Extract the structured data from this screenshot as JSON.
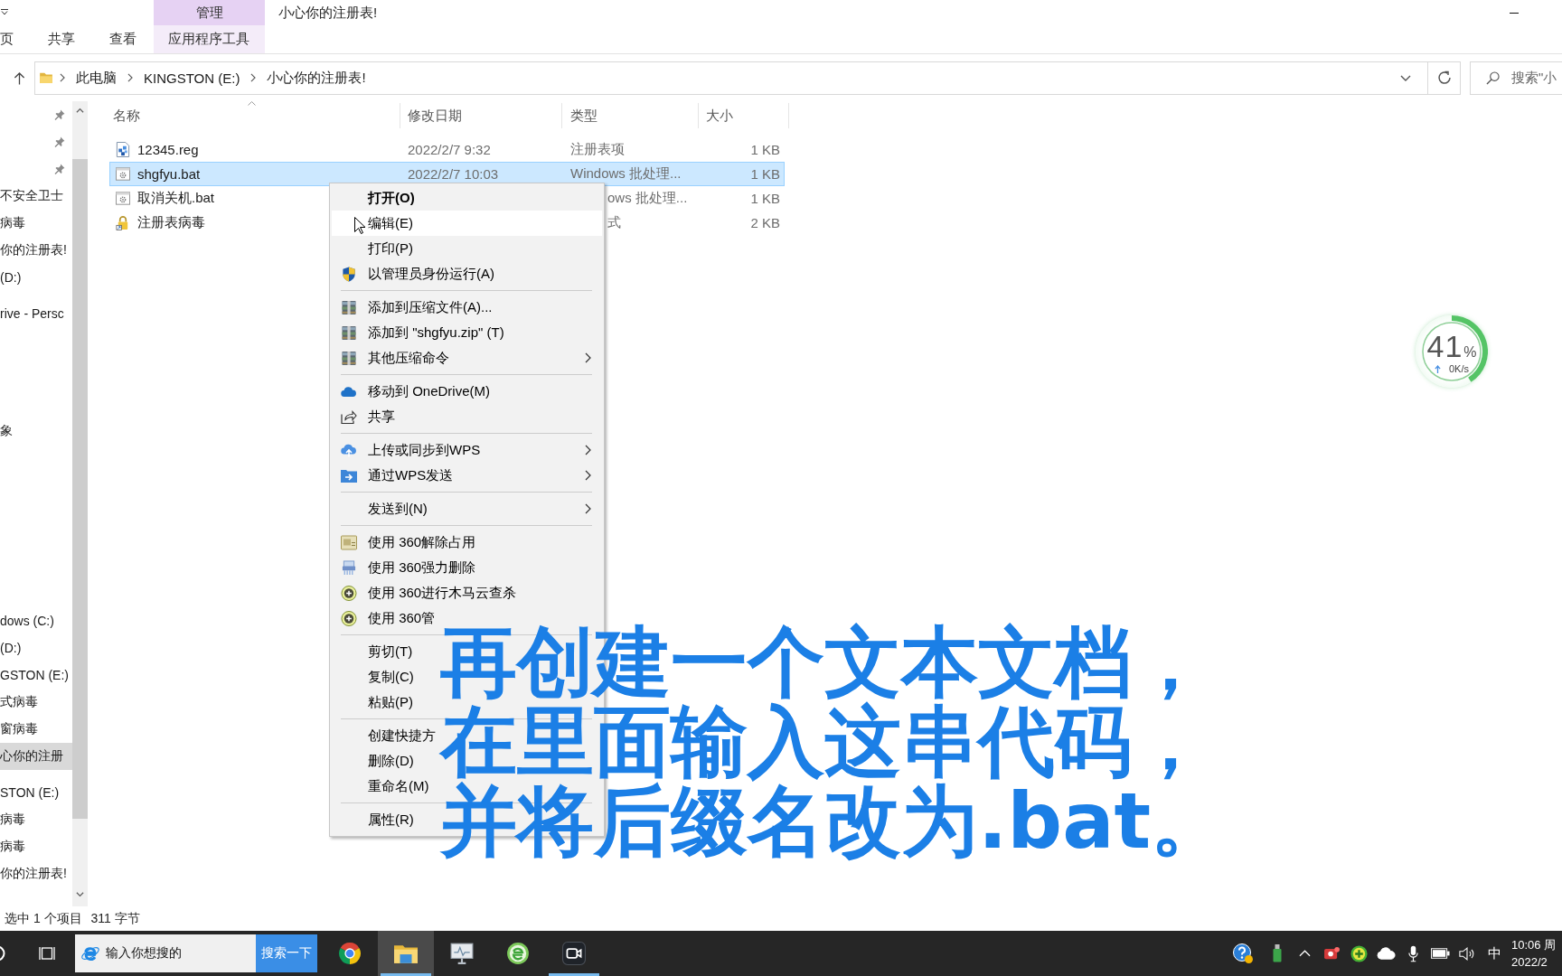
{
  "window": {
    "context_tab_group": "管理",
    "title": "小心你的注册表!"
  },
  "ribbon": {
    "tabs": [
      {
        "label": "页",
        "contextual": false,
        "selected": false
      },
      {
        "label": "共享",
        "contextual": false,
        "selected": false
      },
      {
        "label": "查看",
        "contextual": false,
        "selected": false
      },
      {
        "label": "应用程序工具",
        "contextual": true,
        "selected": false
      }
    ]
  },
  "address_bar": {
    "path": [
      "此电脑",
      "KINGSTON (E:)",
      "小心你的注册表!"
    ]
  },
  "search": {
    "placeholder": "搜索\"小"
  },
  "navigation": {
    "groups": [
      {
        "items": [
          {
            "pinned": true,
            "selected": false
          },
          {
            "pinned": true,
            "selected": false
          },
          {
            "pinned": true,
            "selected": false
          },
          {
            "label": "不安全卫士",
            "pinned": false,
            "selected": false
          },
          {
            "label": "病毒",
            "pinned": false,
            "selected": false
          },
          {
            "label": "你的注册表!",
            "pinned": false,
            "selected": false
          },
          {
            "label": "(D:)",
            "pinned": false,
            "selected": false
          }
        ]
      },
      {
        "items": [
          {
            "label": "rive - Persc",
            "pinned": false,
            "selected": false
          }
        ]
      },
      {
        "items": [
          {
            "label": "象",
            "pinned": false,
            "selected": false
          }
        ]
      },
      {
        "items": [
          {
            "label": "dows (C:)",
            "pinned": false,
            "selected": false
          },
          {
            "label": "(D:)",
            "pinned": false,
            "selected": false
          },
          {
            "label": "GSTON (E:)",
            "pinned": false,
            "selected": false
          },
          {
            "label": "式病毒",
            "pinned": false,
            "selected": false
          },
          {
            "label": "窗病毒",
            "pinned": false,
            "selected": false
          },
          {
            "label": "心你的注册",
            "pinned": false,
            "selected": true
          }
        ]
      },
      {
        "items": [
          {
            "label": "STON (E:)",
            "pinned": false,
            "selected": false
          },
          {
            "label": "病毒",
            "pinned": false,
            "selected": false
          },
          {
            "label": "病毒",
            "pinned": false,
            "selected": false
          },
          {
            "label": "你的注册表!",
            "pinned": false,
            "selected": false
          }
        ]
      }
    ]
  },
  "file_list": {
    "columns": [
      {
        "label": "名称",
        "sorted": true
      },
      {
        "label": "修改日期",
        "sorted": false
      },
      {
        "label": "类型",
        "sorted": false
      },
      {
        "label": "大小",
        "sorted": false
      }
    ],
    "rows": [
      {
        "kind": "reg",
        "name": "12345.reg",
        "modified": "2022/2/7 9:32",
        "type": "注册表项",
        "size": "1 KB",
        "selected": false
      },
      {
        "kind": "bat",
        "name": "shgfyu.bat",
        "modified": "2022/2/7 10:03",
        "type": "Windows 批处理...",
        "size": "1 KB",
        "selected": true
      },
      {
        "kind": "bat",
        "name": "取消关机.bat",
        "type": "ows 批处理...",
        "size": "1 KB",
        "selected": false
      },
      {
        "kind": "shortcut",
        "name": "注册表病毒",
        "type": "式",
        "size": "2 KB",
        "selected": false
      }
    ]
  },
  "context_menu": {
    "groups": [
      {
        "items": [
          {
            "label": "打开(O)",
            "kind": "plain",
            "default": true,
            "selected": false,
            "submenu": false
          },
          {
            "label": "编辑(E)",
            "kind": "plain",
            "default": false,
            "selected": true,
            "submenu": false
          },
          {
            "label": "打印(P)",
            "kind": "plain",
            "default": false,
            "selected": false,
            "submenu": false
          },
          {
            "label": "以管理员身份运行(A)",
            "kind": "shield",
            "default": false,
            "selected": false,
            "submenu": false
          }
        ]
      },
      {
        "items": [
          {
            "label": "添加到压缩文件(A)...",
            "kind": "archive",
            "default": false,
            "selected": false,
            "submenu": false
          },
          {
            "label": "添加到 \"shgfyu.zip\" (T)",
            "kind": "archive",
            "default": false,
            "selected": false,
            "submenu": false
          },
          {
            "label": "其他压缩命令",
            "kind": "archive",
            "default": false,
            "selected": false,
            "submenu": true
          }
        ]
      },
      {
        "items": [
          {
            "label": "移动到 OneDrive(M)",
            "kind": "onedrive",
            "default": false,
            "selected": false,
            "submenu": false
          },
          {
            "label": "共享",
            "kind": "share",
            "default": false,
            "selected": false,
            "submenu": false
          }
        ]
      },
      {
        "items": [
          {
            "label": "上传或同步到WPS",
            "kind": "upload",
            "default": false,
            "selected": false,
            "submenu": true
          },
          {
            "label": "通过WPS发送",
            "kind": "send",
            "default": false,
            "selected": false,
            "submenu": true
          }
        ]
      },
      {
        "items": [
          {
            "label": "发送到(N)",
            "kind": "plain",
            "default": false,
            "selected": false,
            "submenu": true
          }
        ]
      },
      {
        "items": [
          {
            "label": "使用 360解除占用",
            "kind": "unlock",
            "default": false,
            "selected": false,
            "submenu": false
          },
          {
            "label": "使用 360强力删除",
            "kind": "shred",
            "default": false,
            "selected": false,
            "submenu": false
          },
          {
            "label": "使用 360进行木马云查杀",
            "kind": "scan",
            "default": false,
            "selected": false,
            "submenu": false
          },
          {
            "label": "使用 360管",
            "kind": "scan",
            "default": false,
            "selected": false,
            "submenu": false
          }
        ]
      },
      {
        "items": [
          {
            "label": "剪切(T)",
            "kind": "plain",
            "default": false,
            "selected": false,
            "submenu": false
          },
          {
            "label": "复制(C)",
            "kind": "plain",
            "default": false,
            "selected": false,
            "submenu": false
          },
          {
            "label": "粘贴(P)",
            "kind": "plain",
            "default": false,
            "selected": false,
            "submenu": false
          }
        ]
      },
      {
        "items": [
          {
            "label": "创建快捷方",
            "kind": "plain",
            "default": false,
            "selected": false,
            "submenu": false
          },
          {
            "label": "删除(D)",
            "kind": "plain",
            "default": false,
            "selected": false,
            "submenu": false
          },
          {
            "label": "重命名(M)",
            "kind": "plain",
            "default": false,
            "selected": false,
            "submenu": false
          }
        ]
      },
      {
        "items": [
          {
            "label": "属性(R)",
            "kind": "plain",
            "default": false,
            "selected": false,
            "submenu": false
          }
        ]
      }
    ]
  },
  "caption": {
    "lines": [
      "再创建一个文本文档，",
      "在里面输入这串代码，",
      "并将后缀名改为.bat。"
    ]
  },
  "float_widget": {
    "value": "41",
    "unit": "%",
    "speed": "0K/s",
    "level": 0.41
  },
  "status_bar": {
    "selection": "选中 1 个项目",
    "size": "311 字节"
  },
  "taskbar": {
    "search": {
      "placeholder": "输入你想搜的",
      "button": "搜索一下"
    },
    "apps": [
      {
        "kind": "chrome",
        "selected": false,
        "running": false
      },
      {
        "kind": "explorer",
        "selected": true,
        "running": true
      },
      {
        "kind": "app",
        "selected": false,
        "running": false
      },
      {
        "kind": "browser",
        "selected": false,
        "running": false
      },
      {
        "kind": "recorder",
        "selected": false,
        "running": true
      }
    ],
    "tray": [
      {
        "kind": "help"
      },
      {
        "kind": "usb"
      },
      {
        "kind": "overflow"
      },
      {
        "kind": "record"
      },
      {
        "kind": "guard"
      },
      {
        "kind": "cloud"
      },
      {
        "kind": "mic"
      },
      {
        "kind": "battery"
      },
      {
        "kind": "speaker"
      }
    ],
    "ime": "中",
    "time": "10:06 周",
    "date": "2022/2"
  }
}
